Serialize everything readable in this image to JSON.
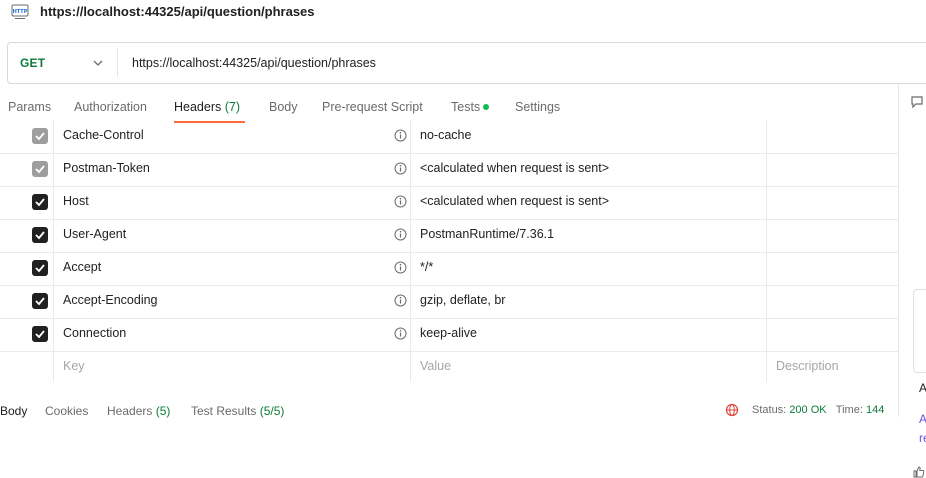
{
  "window": {
    "title": "https://localhost:44325/api/question/phrases"
  },
  "request": {
    "method": "GET",
    "url": "https://localhost:44325/api/question/phrases"
  },
  "tabs": [
    {
      "label": "Params"
    },
    {
      "label": "Authorization"
    },
    {
      "label": "Headers",
      "count": "(7)"
    },
    {
      "label": "Body"
    },
    {
      "label": "Pre-request Script"
    },
    {
      "label": "Tests"
    },
    {
      "label": "Settings"
    }
  ],
  "headers": {
    "rows": [
      {
        "key": "Cache-Control",
        "value": "no-cache",
        "checked": true,
        "disabled": true
      },
      {
        "key": "Postman-Token",
        "value": "<calculated when request is sent>",
        "checked": true,
        "disabled": true
      },
      {
        "key": "Host",
        "value": "<calculated when request is sent>",
        "checked": true,
        "disabled": false
      },
      {
        "key": "User-Agent",
        "value": "PostmanRuntime/7.36.1",
        "checked": true,
        "disabled": false
      },
      {
        "key": "Accept",
        "value": "*/*",
        "checked": true,
        "disabled": false
      },
      {
        "key": "Accept-Encoding",
        "value": "gzip, deflate, br",
        "checked": true,
        "disabled": false
      },
      {
        "key": "Connection",
        "value": "keep-alive",
        "checked": true,
        "disabled": false
      }
    ],
    "placeholders": {
      "key": "Key",
      "value": "Value",
      "description": "Description"
    }
  },
  "bottom": {
    "tabs": [
      {
        "label": "Body"
      },
      {
        "label": "Cookies"
      },
      {
        "label": "Headers",
        "count": "(5)"
      },
      {
        "label": "Test Results",
        "count": "(5/5)"
      }
    ],
    "status_label": "Status:",
    "status_value": "200 OK",
    "time_label": "Time:",
    "time_value": "144"
  },
  "right_panel": {
    "title_initial": "A",
    "link_line1": "A",
    "link_line2": "re"
  },
  "colors": {
    "accent": "#ff6c37",
    "method_get": "#0b7c3a",
    "success": "#0cbb52",
    "link": "#6f4ee8"
  }
}
